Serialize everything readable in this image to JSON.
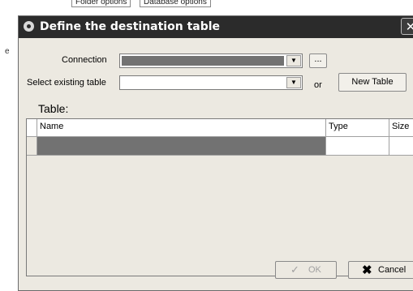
{
  "background": {
    "tabs": [
      "Folder options",
      "Database options"
    ],
    "left_fragment": "e"
  },
  "dialog": {
    "title": "Define the destination table",
    "title_icon": "gear-icon",
    "close_glyph": "✕"
  },
  "form": {
    "connection_label": "Connection",
    "connection_value": "",
    "browse_label": "...",
    "existing_table_label": "Select existing table",
    "existing_table_value": "",
    "or_label": "or",
    "new_table_label": "New Table",
    "table_caption": "Table:"
  },
  "table": {
    "columns": [
      "Name",
      "Type",
      "Size"
    ],
    "rows": [
      {
        "name": "",
        "type": "",
        "size": ""
      }
    ]
  },
  "footer": {
    "ok_label": "OK",
    "cancel_label": "Cancel"
  },
  "colors": {
    "title_bar": "#2b2b2b",
    "dialog_bg": "#ece9e1",
    "selected_fill": "#727272",
    "cancel_icon": "#111111",
    "ok_disabled": "#a0a0a0"
  }
}
